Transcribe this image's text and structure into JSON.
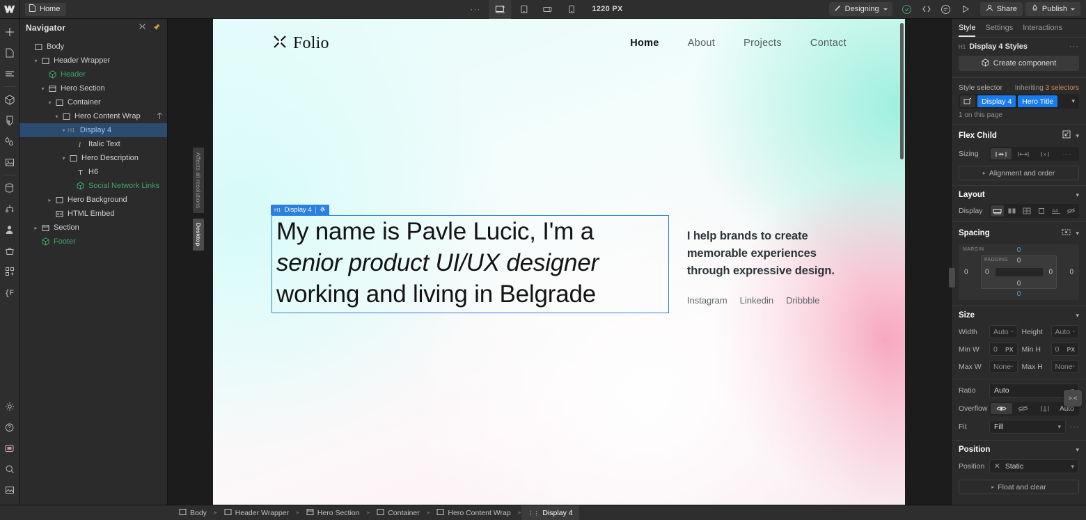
{
  "topbar": {
    "page_chip": "Home",
    "dots": "···",
    "breakpoints": [
      {
        "name": "desktop",
        "active": true
      },
      {
        "name": "tablet",
        "active": false
      },
      {
        "name": "mobile-landscape",
        "active": false
      },
      {
        "name": "mobile-portrait",
        "active": false
      }
    ],
    "canvas_width": "1220 PX",
    "mode": "Designing",
    "share": "Share",
    "publish": "Publish",
    "icons": [
      "audit-check-icon",
      "code-export-icon",
      "comment-icon",
      "preview-play-icon"
    ]
  },
  "rail": {
    "top_items": [
      {
        "name": "add-element-icon"
      },
      {
        "name": "pages-icon"
      },
      {
        "name": "navigator-icon"
      },
      {
        "name": "components-icon"
      },
      {
        "name": "style-manager-icon"
      },
      {
        "name": "variables-icon"
      },
      {
        "name": "assets-icon"
      },
      {
        "name": "cms-icon"
      },
      {
        "name": "logic-icon"
      },
      {
        "name": "users-icon"
      },
      {
        "name": "ecommerce-icon"
      },
      {
        "name": "apps-icon"
      },
      {
        "name": "code-icon"
      }
    ],
    "bottom_items": [
      {
        "name": "settings-gear-icon"
      },
      {
        "name": "help-icon"
      },
      {
        "name": "video-tutorial-icon"
      },
      {
        "name": "search-icon"
      },
      {
        "name": "export-image-icon"
      }
    ]
  },
  "navigator": {
    "title": "Navigator",
    "items": [
      {
        "label": "Body",
        "indent": 0,
        "icon": "body-icon",
        "twist": "",
        "color": "default",
        "selected": false
      },
      {
        "label": "Header Wrapper",
        "indent": 1,
        "icon": "div-icon",
        "twist": "v",
        "color": "default",
        "selected": false
      },
      {
        "label": "Header",
        "indent": 2,
        "icon": "component-icon",
        "twist": "",
        "color": "green",
        "selected": false
      },
      {
        "label": "Hero Section",
        "indent": 2,
        "icon": "section-icon",
        "twist": "v",
        "color": "default",
        "selected": false
      },
      {
        "label": "Container",
        "indent": 3,
        "icon": "div-icon",
        "twist": "v",
        "color": "default",
        "selected": false
      },
      {
        "label": "Hero Content Wrap",
        "indent": 4,
        "icon": "div-icon",
        "twist": "v",
        "color": "default",
        "selected": false,
        "tail": "flex-icon"
      },
      {
        "label": "Display 4",
        "indent": 5,
        "icon": "",
        "twist": "v",
        "color": "blue",
        "selected": true,
        "tag": "H1"
      },
      {
        "label": "Italic Text",
        "indent": 6,
        "icon": "italic-icon",
        "twist": "",
        "color": "default",
        "selected": false
      },
      {
        "label": "Hero Description",
        "indent": 5,
        "icon": "div-icon",
        "twist": "v",
        "color": "default",
        "selected": false
      },
      {
        "label": "H6",
        "indent": 6,
        "icon": "text-icon",
        "twist": "",
        "color": "default",
        "selected": false
      },
      {
        "label": "Social Network Links",
        "indent": 6,
        "icon": "component-icon",
        "twist": "",
        "color": "green",
        "selected": false
      },
      {
        "label": "Hero Background",
        "indent": 3,
        "icon": "div-icon",
        "twist": ">",
        "color": "default",
        "selected": false
      },
      {
        "label": "HTML Embed",
        "indent": 3,
        "icon": "embed-icon",
        "twist": "",
        "color": "default",
        "selected": false
      },
      {
        "label": "Section",
        "indent": 1,
        "icon": "section-icon",
        "twist": ">",
        "color": "default",
        "selected": false
      },
      {
        "label": "Footer",
        "indent": 1,
        "icon": "component-icon",
        "twist": "",
        "color": "green",
        "selected": false
      }
    ]
  },
  "canvas": {
    "res_hint": "Affects all resolutions",
    "res_current": "Desktop",
    "site": {
      "brand": "Folio",
      "nav_links": [
        {
          "label": "Home",
          "active": true
        },
        {
          "label": "About",
          "active": false
        },
        {
          "label": "Projects",
          "active": false
        },
        {
          "label": "Contact",
          "active": false
        }
      ],
      "selection_badge": {
        "tag": "H1",
        "label": "Display 4"
      },
      "hero_title_line1": "My name is Pavle Lucic, I'm a ",
      "hero_title_italic": "senior product UI/UX designer",
      "hero_title_line3": " working and living in Belgrade",
      "hero_description": "I help brands to create memorable experiences through expressive design.",
      "social_links": [
        "Instagram",
        "Linkedin",
        "Dribbble"
      ]
    }
  },
  "right_panel": {
    "tabs": [
      {
        "label": "Style",
        "active": true
      },
      {
        "label": "Settings",
        "active": false
      },
      {
        "label": "Interactions",
        "active": false
      }
    ],
    "selected_tag": "H1",
    "selected_styles": "Display 4 Styles",
    "create_component": "Create component",
    "style_selector_label": "Style selector",
    "inheriting_prefix": "Inheriting ",
    "inheriting_count": "3 selectors",
    "class_chips": [
      "Display 4",
      "Hero Title"
    ],
    "on_this_page": "1 on this page",
    "flex_child": {
      "title": "Flex Child",
      "sizing_label": "Sizing",
      "sizing_options": [
        "shrink-icon",
        "grow-icon",
        "fixed-icon",
        "more-icon"
      ],
      "sizing_active": 0,
      "alignment_button": "Alignment and order"
    },
    "layout": {
      "title": "Layout",
      "display_label": "Display",
      "display_options": [
        "block-icon",
        "flex-icon",
        "grid-icon",
        "inline-block-icon",
        "inline-icon",
        "none-icon"
      ],
      "display_active": 0
    },
    "spacing": {
      "title": "Spacing",
      "margin_label": "MARGIN",
      "padding_label": "PADDING",
      "margin_top": "0",
      "margin_bottom": "0",
      "margin_left": "0",
      "margin_right": "0",
      "padding_top": "0",
      "padding_bottom": "0",
      "padding_left": "0",
      "padding_right": "0"
    },
    "size": {
      "title": "Size",
      "width_label": "Width",
      "width_value": "Auto",
      "height_label": "Height",
      "height_value": "Auto",
      "minw_label": "Min W",
      "minw_value": "0",
      "minw_unit": "PX",
      "minh_label": "Min H",
      "minh_value": "0",
      "minh_unit": "PX",
      "maxw_label": "Max W",
      "maxw_value": "None",
      "maxh_label": "Max H",
      "maxh_value": "None",
      "ratio_label": "Ratio",
      "ratio_value": "Auto",
      "overflow_label": "Overflow",
      "overflow_options": [
        "visible-eye-icon",
        "hidden-eye-icon",
        "scroll-icon",
        "Auto"
      ],
      "overflow_active": 0,
      "fit_label": "Fit",
      "fit_value": "Fill"
    },
    "position": {
      "title": "Position",
      "label": "Position",
      "value": "Static",
      "float_button": "Float and clear"
    },
    "floating_cursor": ">.<"
  },
  "breadcrumbs": [
    {
      "label": "Body",
      "icon": "body-icon",
      "active": false
    },
    {
      "label": "Header Wrapper",
      "icon": "div-icon",
      "active": false
    },
    {
      "label": "Hero Section",
      "icon": "section-icon",
      "active": false
    },
    {
      "label": "Container",
      "icon": "div-icon",
      "active": false
    },
    {
      "label": "Hero Content Wrap",
      "icon": "div-icon",
      "active": false
    },
    {
      "label": "Display 4",
      "icon": "h1-icon",
      "active": true
    }
  ],
  "colors": {
    "accent_blue": "#187cf0",
    "selection_blue": "#2b7fe0",
    "component_green": "#3fa46a",
    "inherit_orange": "#d08a5a"
  }
}
